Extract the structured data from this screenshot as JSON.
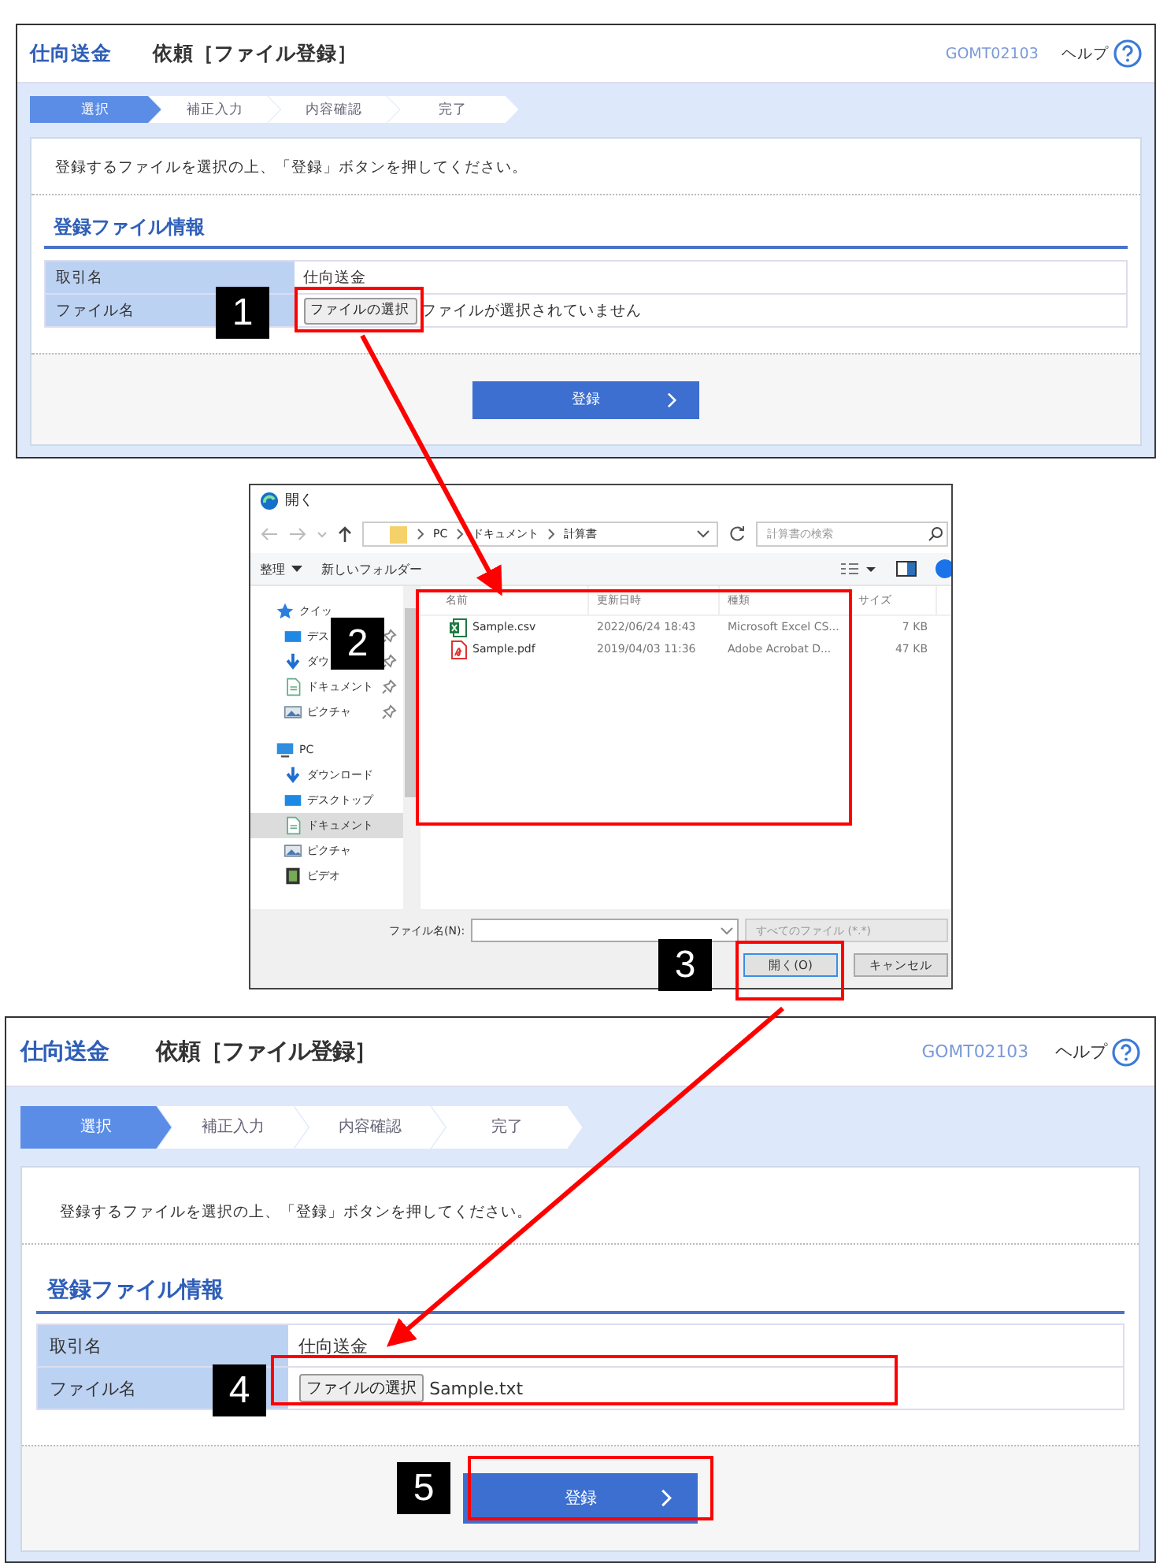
{
  "top_form": {
    "app_title": "仕向送金",
    "title": "依頼［ファイル登録］",
    "screen_id": "GOMT02103",
    "help": "ヘルプ",
    "steps": [
      {
        "label": "選択",
        "selected": true
      },
      {
        "label": "補正入力",
        "selected": false
      },
      {
        "label": "内容確認",
        "selected": false
      },
      {
        "label": "完了",
        "selected": false
      }
    ],
    "instruction": "登録するファイルを選択の上、「登録」ボタンを押してください。",
    "section_title": "登録ファイル情報",
    "fields": [
      {
        "kind": "text",
        "label": "取引名",
        "value": "仕向送金"
      },
      {
        "kind": "file",
        "label": "ファイル名",
        "button": "ファイルの選択",
        "value": "ファイルが選択されていません"
      }
    ],
    "submit": "登録"
  },
  "file_dialog": {
    "title": "開く",
    "path": [
      "PC",
      "ドキュメント",
      "計算書"
    ],
    "search_placeholder": "計算書の検索",
    "organize": "整理",
    "new_folder": "新しいフォルダー",
    "nav": [
      {
        "kind": "star",
        "label": "クイッ",
        "selected": false,
        "children": [
          {
            "kind": "desktop",
            "label": "デス",
            "pinned": true,
            "selected": false
          },
          {
            "kind": "download",
            "label": "ダウ",
            "pinned": true,
            "selected": false
          },
          {
            "kind": "document",
            "label": "ドキュメント",
            "pinned": true,
            "selected": false
          },
          {
            "kind": "picture",
            "label": "ピクチャ",
            "pinned": true,
            "selected": false
          }
        ]
      },
      {
        "kind": "pc",
        "label": "PC",
        "selected": false,
        "children": [
          {
            "kind": "download",
            "label": "ダウンロード",
            "pinned": false,
            "selected": false
          },
          {
            "kind": "desktop",
            "label": "デスクトップ",
            "pinned": false,
            "selected": false
          },
          {
            "kind": "document",
            "label": "ドキュメント",
            "pinned": false,
            "selected": true
          },
          {
            "kind": "picture",
            "label": "ピクチャ",
            "pinned": false,
            "selected": false
          },
          {
            "kind": "video",
            "label": "ビデオ",
            "pinned": false,
            "selected": false
          }
        ]
      }
    ],
    "columns": [
      "名前",
      "更新日時",
      "種類",
      "サイズ"
    ],
    "files": [
      {
        "kind": "excel",
        "name": "Sample.csv",
        "modified": "2022/06/24 18:43",
        "type": "Microsoft Excel CS...",
        "size": "7 KB"
      },
      {
        "kind": "pdf",
        "name": "Sample.pdf",
        "modified": "2019/04/03 11:36",
        "type": "Adobe Acrobat D...",
        "size": "47 KB"
      }
    ],
    "filename_label": "ファイル名(N):",
    "filter": "すべてのファイル (*.*)",
    "open_button": "開く(O)",
    "cancel_button": "キャンセル"
  },
  "bottom_form": {
    "app_title": "仕向送金",
    "title": "依頼［ファイル登録］",
    "screen_id": "GOMT02103",
    "help": "ヘルプ",
    "steps": [
      {
        "label": "選択",
        "selected": true
      },
      {
        "label": "補正入力",
        "selected": false
      },
      {
        "label": "内容確認",
        "selected": false
      },
      {
        "label": "完了",
        "selected": false
      }
    ],
    "instruction": "登録するファイルを選択の上、「登録」ボタンを押してください。",
    "section_title": "登録ファイル情報",
    "fields": [
      {
        "kind": "text",
        "label": "取引名",
        "value": "仕向送金"
      },
      {
        "kind": "file",
        "label": "ファイル名",
        "button": "ファイルの選択",
        "value": "Sample.txt"
      }
    ],
    "submit": "登録"
  },
  "callouts": [
    {
      "number": "1"
    },
    {
      "number": "2"
    },
    {
      "number": "3"
    },
    {
      "number": "4"
    },
    {
      "number": "5"
    }
  ]
}
